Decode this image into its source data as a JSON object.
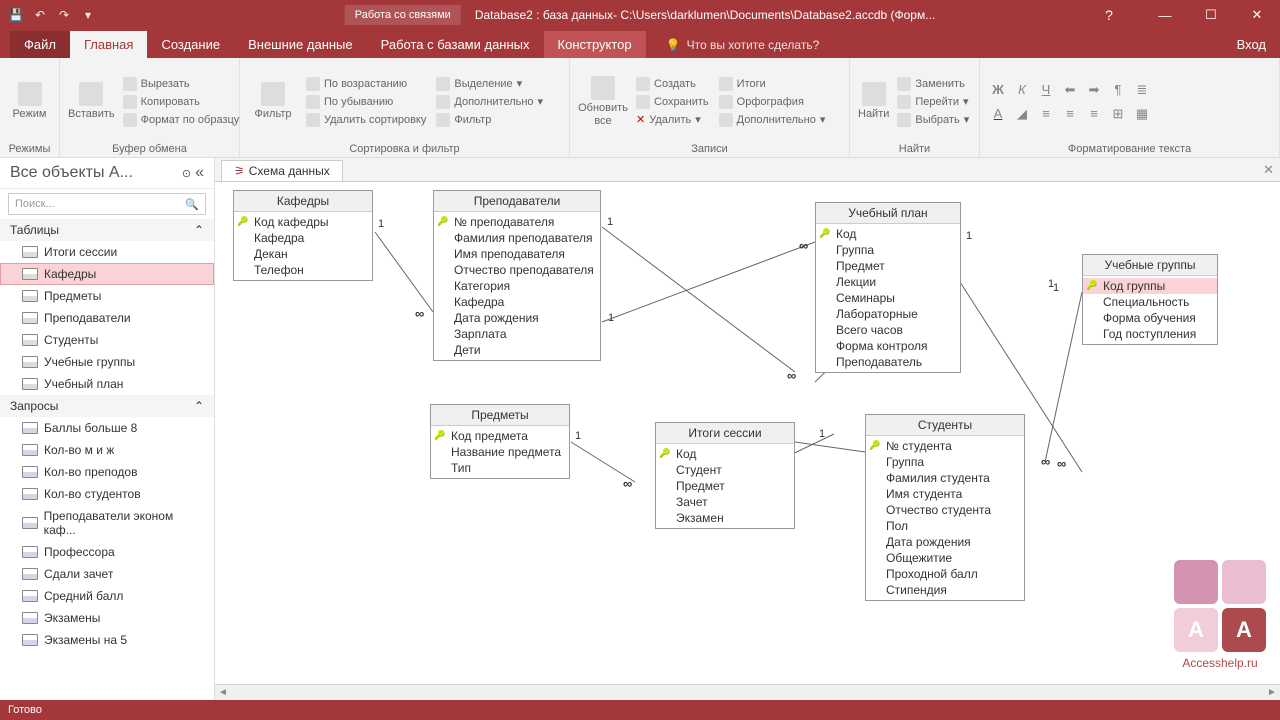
{
  "titlebar": {
    "context_label": "Работа со связями",
    "title": "Database2 : база данных- C:\\Users\\darklumen\\Documents\\Database2.accdb (Форм..."
  },
  "tabs": {
    "file": "Файл",
    "home": "Главная",
    "create": "Создание",
    "external": "Внешние данные",
    "dbtools": "Работа с базами данных",
    "design": "Конструктор",
    "tellme": "Что вы хотите сделать?",
    "login": "Вход"
  },
  "ribbon": {
    "groups": {
      "modes": "Режимы",
      "clipboard": "Буфер обмена",
      "sortfilter": "Сортировка и фильтр",
      "records": "Записи",
      "find": "Найти",
      "textfmt": "Форматирование текста"
    },
    "buttons": {
      "mode": "Режим",
      "paste": "Вставить",
      "cut": "Вырезать",
      "copy": "Копировать",
      "formatpainter": "Формат по образцу",
      "filter": "Фильтр",
      "asc": "По возрастанию",
      "desc": "По убыванию",
      "clearsort": "Удалить сортировку",
      "selection": "Выделение",
      "advanced": "Дополнительно",
      "toggle": "Фильтр",
      "refresh": "Обновить все",
      "new": "Создать",
      "save": "Сохранить",
      "delete": "Удалить",
      "totals": "Итоги",
      "spelling": "Орфография",
      "more": "Дополнительно",
      "find": "Найти",
      "replace": "Заменить",
      "goto": "Перейти",
      "select": "Выбрать"
    }
  },
  "nav": {
    "header": "Все объекты A...",
    "search": "Поиск...",
    "groups": {
      "tables": "Таблицы",
      "queries": "Запросы"
    },
    "tables": [
      "Итоги сессии",
      "Кафедры",
      "Предметы",
      "Преподаватели",
      "Студенты",
      "Учебные группы",
      "Учебный план"
    ],
    "queries": [
      "Баллы больше 8",
      "Кол-во м и ж",
      "Кол-во преподов",
      "Кол-во студентов",
      "Преподаватели эконом каф...",
      "Профессора",
      "Сдали зачет",
      "Средний балл",
      "Экзамены",
      "Экзамены на 5"
    ]
  },
  "doc_tab": "Схема данных",
  "boxes": {
    "kafedry": {
      "title": "Кафедры",
      "fields": [
        "Код кафедры",
        "Кафедра",
        "Декан",
        "Телефон"
      ],
      "keys": [
        0
      ]
    },
    "prepod": {
      "title": "Преподаватели",
      "fields": [
        "№ преподавателя",
        "Фамилия преподавателя",
        "Имя преподавателя",
        "Отчество преподавателя",
        "Категория",
        "Кафедра",
        "Дата рождения",
        "Зарплата",
        "Дети"
      ],
      "keys": [
        0
      ]
    },
    "plan": {
      "title": "Учебный план",
      "fields": [
        "Код",
        "Группа",
        "Предмет",
        "Лекции",
        "Семинары",
        "Лабораторные",
        "Всего часов",
        "Форма контроля",
        "Преподаватель"
      ],
      "keys": [
        0
      ]
    },
    "groups": {
      "title": "Учебные группы",
      "fields": [
        "Код группы",
        "Специальность",
        "Форма обучения",
        "Год поступления"
      ],
      "keys": [
        0
      ]
    },
    "predmety": {
      "title": "Предметы",
      "fields": [
        "Код предмета",
        "Название предмета",
        "Тип"
      ],
      "keys": [
        0
      ]
    },
    "itogi": {
      "title": "Итоги сессии",
      "fields": [
        "Код",
        "Студент",
        "Предмет",
        "Зачет",
        "Экзамен"
      ],
      "keys": [
        0
      ]
    },
    "students": {
      "title": "Студенты",
      "fields": [
        "№ студента",
        "Группа",
        "Фамилия студента",
        "Имя студента",
        "Отчество студента",
        "Пол",
        "Дата рождения",
        "Общежитие",
        "Проходной балл",
        "Стипендия"
      ],
      "keys": [
        0
      ]
    }
  },
  "status": "Готово",
  "watermark": "Accesshelp.ru"
}
